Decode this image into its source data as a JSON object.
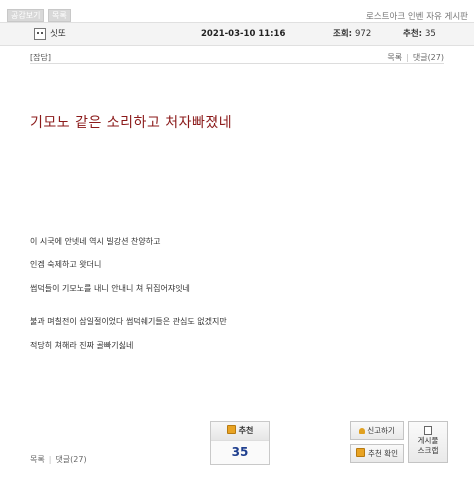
{
  "top_buttons": [
    "공감보기",
    "목록"
  ],
  "board_name": "로스트아크 인벤 자유 게시판",
  "post": {
    "author": "싯또",
    "date": "2021-03-10 11:16",
    "views_label": "조회:",
    "views": "972",
    "recs_label": "추천:",
    "recs": "35",
    "category": "[잡담]",
    "title": "기모노 같은 소리하고 처자빠졌네",
    "lines": [
      "이 시국에 안넷네 역시 빌강션 찬양하고",
      "인겜 숙제하고 왓더니",
      "썹덕들이 기모노를 내니 안내니 쳐 뒤집어쟈잇네",
      "불과 며칠전이 삼일절이었다 썹덕쉐기들은 관심도 없겠지만",
      "적당히 쳐해라 진짜 골빠기싫네"
    ]
  },
  "nav": {
    "list": "목록",
    "comments": "댓글(27)"
  },
  "recommend": {
    "label": "추천",
    "count": "35"
  },
  "actions": {
    "report": "신고하기",
    "check_recs": "추천 확인",
    "scrap_line1": "게시물",
    "scrap_line2": "스크랩"
  },
  "colors": {
    "title": "#8b1a1a",
    "rec_count": "#1f3f8f",
    "thumb": "#e8a323"
  }
}
